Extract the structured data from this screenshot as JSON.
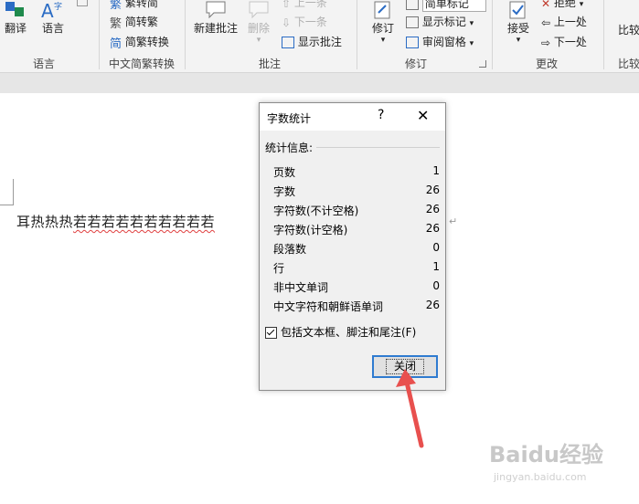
{
  "ribbon": {
    "groups": {
      "language": "语言",
      "chinese_conversion": "中文简繁转换",
      "comments": "批注",
      "tracking": "修订",
      "changes": "更改",
      "compare": "比较"
    },
    "buttons": {
      "translate": "翻译",
      "language": "语言",
      "trad_to_simp": "繁转简",
      "simp_to_trad": "简转繁",
      "simp_trad_convert": "简繁转换",
      "new_comment": "新建批注",
      "delete": "删除",
      "prev_comment": "上一条",
      "next_comment": "下一条",
      "show_comments": "显示批注",
      "track_changes": "修订",
      "simple_markup": "简单标记",
      "show_markup": "显示标记",
      "review_pane": "审阅窗格",
      "accept": "接受",
      "reject": "拒绝",
      "prev_change": "上一处",
      "next_change": "下一处",
      "compare": "比较"
    }
  },
  "document": {
    "text_plain": "耳热热热",
    "text_flagged": "若若若若若若若若若若"
  },
  "dialog": {
    "title": "字数统计",
    "help": "?",
    "close_symbol": "✕",
    "section_label": "统计信息:",
    "rows": [
      {
        "label": "页数",
        "value": "1"
      },
      {
        "label": "字数",
        "value": "26"
      },
      {
        "label": "字符数(不计空格)",
        "value": "26"
      },
      {
        "label": "字符数(计空格)",
        "value": "26"
      },
      {
        "label": "段落数",
        "value": "0"
      },
      {
        "label": "行",
        "value": "1"
      },
      {
        "label": "非中文单词",
        "value": "0"
      },
      {
        "label": "中文字符和朝鲜语单词",
        "value": "26"
      }
    ],
    "checkbox_label": "包括文本框、脚注和尾注(F)",
    "checkbox_checked": true,
    "close_button": "关闭"
  },
  "annotation": {
    "arrow_color": "#e8504e"
  },
  "watermark": {
    "main": "Baidu经验",
    "sub": "jingyan.baidu.com"
  },
  "colors": {
    "accent": "#2f7bd0",
    "ribbon_bg": "#f3f3f3",
    "dialog_bg": "#f0f0f0"
  }
}
